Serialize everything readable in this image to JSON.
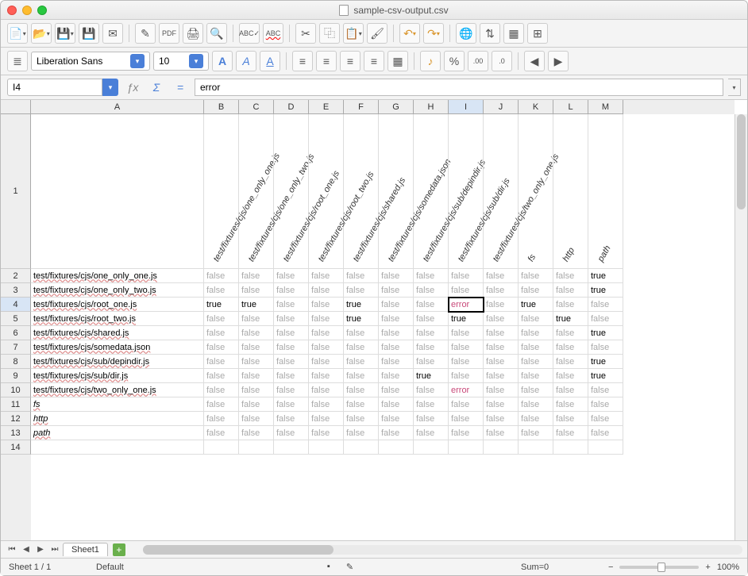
{
  "window": {
    "title": "sample-csv-output.csv"
  },
  "font": {
    "name": "Liberation Sans",
    "size": "10"
  },
  "cellref": {
    "name": "I4",
    "formula": "error"
  },
  "colWidths": {
    "A": 218,
    "other": 44
  },
  "columns": [
    "A",
    "B",
    "C",
    "D",
    "E",
    "F",
    "G",
    "H",
    "I",
    "J",
    "K",
    "L",
    "M"
  ],
  "selectedCell": {
    "row": 4,
    "col": "I"
  },
  "headerRow": {
    "B": "test/fixtures/cjs/one_only_one.js",
    "C": "test/fixtures/cjs/one_only_two.js",
    "D": "test/fixtures/cjs/root_one.js",
    "E": "test/fixtures/cjs/root_two.js",
    "F": "test/fixtures/cjs/shared.js",
    "G": "test/fixtures/cjs/somedata.json",
    "H": "test/fixtures/cjs/sub/depindir.js",
    "I": "test/fixtures/cjs/sub/dir.js",
    "J": "test/fixtures/cjs/two_only_one.js",
    "K": "fs",
    "L": "http",
    "M": "path"
  },
  "rows": [
    {
      "n": 2,
      "A": "test/fixtures/cjs/one_only_one.js",
      "cells": [
        "false",
        "false",
        "false",
        "false",
        "false",
        "false",
        "false",
        "false",
        "false",
        "false",
        "false",
        "true"
      ]
    },
    {
      "n": 3,
      "A": "test/fixtures/cjs/one_only_two.js",
      "cells": [
        "false",
        "false",
        "false",
        "false",
        "false",
        "false",
        "false",
        "false",
        "false",
        "false",
        "false",
        "true"
      ]
    },
    {
      "n": 4,
      "A": "test/fixtures/cjs/root_one.js",
      "cells": [
        "true",
        "true",
        "false",
        "false",
        "true",
        "false",
        "false",
        "error",
        "false",
        "true",
        "false",
        "false"
      ]
    },
    {
      "n": 5,
      "A": "test/fixtures/cjs/root_two.js",
      "cells": [
        "false",
        "false",
        "false",
        "false",
        "true",
        "false",
        "false",
        "true",
        "false",
        "false",
        "true",
        "false"
      ]
    },
    {
      "n": 6,
      "A": "test/fixtures/cjs/shared.js",
      "cells": [
        "false",
        "false",
        "false",
        "false",
        "false",
        "false",
        "false",
        "false",
        "false",
        "false",
        "false",
        "true"
      ]
    },
    {
      "n": 7,
      "A": "test/fixtures/cjs/somedata.json",
      "cells": [
        "false",
        "false",
        "false",
        "false",
        "false",
        "false",
        "false",
        "false",
        "false",
        "false",
        "false",
        "false"
      ]
    },
    {
      "n": 8,
      "A": "test/fixtures/cjs/sub/depindir.js",
      "cells": [
        "false",
        "false",
        "false",
        "false",
        "false",
        "false",
        "false",
        "false",
        "false",
        "false",
        "false",
        "true"
      ]
    },
    {
      "n": 9,
      "A": "test/fixtures/cjs/sub/dir.js",
      "cells": [
        "false",
        "false",
        "false",
        "false",
        "false",
        "false",
        "true",
        "false",
        "false",
        "false",
        "false",
        "true"
      ]
    },
    {
      "n": 10,
      "A": "test/fixtures/cjs/two_only_one.js",
      "cells": [
        "false",
        "false",
        "false",
        "false",
        "false",
        "false",
        "false",
        "error",
        "false",
        "false",
        "false",
        "false"
      ]
    },
    {
      "n": 11,
      "A": "fs",
      "italic": true,
      "cells": [
        "false",
        "false",
        "false",
        "false",
        "false",
        "false",
        "false",
        "false",
        "false",
        "false",
        "false",
        "false"
      ]
    },
    {
      "n": 12,
      "A": "http",
      "italic": true,
      "cells": [
        "false",
        "false",
        "false",
        "false",
        "false",
        "false",
        "false",
        "false",
        "false",
        "false",
        "false",
        "false"
      ]
    },
    {
      "n": 13,
      "A": "path",
      "italic": true,
      "cells": [
        "false",
        "false",
        "false",
        "false",
        "false",
        "false",
        "false",
        "false",
        "false",
        "false",
        "false",
        "false"
      ]
    },
    {
      "n": 14,
      "A": "",
      "cells": [
        "",
        "",
        "",
        "",
        "",
        "",
        "",
        "",
        "",
        "",
        "",
        ""
      ]
    }
  ],
  "tabs": {
    "active": "Sheet1"
  },
  "status": {
    "sheet": "Sheet 1 / 1",
    "style": "Default",
    "sum": "Sum=0",
    "zoom": "100%"
  }
}
